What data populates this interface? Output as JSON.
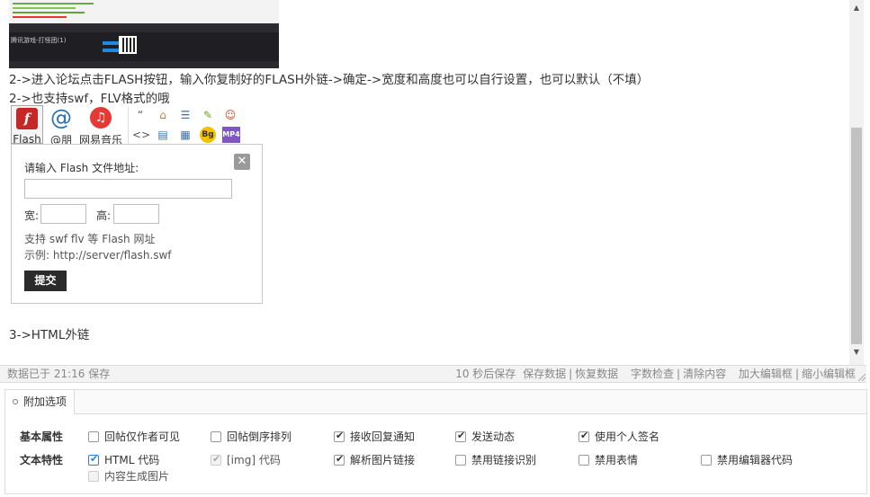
{
  "editor": {
    "line_flash_steps": "2->进入论坛点击FLASH按钮，输入你复制好的FLASH外链->确定->宽度和高度也可以自行设置，也可以默认（不填）",
    "line_swf_flv": "2->也支持swf，FLV格式的哦",
    "line_html": "3->HTML外链",
    "thumb_title": "腾讯游戏-打怪团(1)"
  },
  "toolbar": {
    "flash_label": "Flash",
    "at_label": "@朋",
    "music_label": "网易音乐",
    "flash_icon": "f",
    "music_icon": "♫",
    "small_icons": [
      {
        "name": "quote-icon",
        "glyph": "“"
      },
      {
        "name": "free-icon",
        "glyph": "⌂"
      },
      {
        "name": "hide-icon",
        "glyph": "☰"
      },
      {
        "name": "find-icon",
        "glyph": "✎"
      },
      {
        "name": "qq-icon",
        "glyph": "☺"
      },
      {
        "name": "code-icon",
        "glyph": "<>"
      },
      {
        "name": "page-icon",
        "glyph": "▤"
      },
      {
        "name": "table-icon",
        "glyph": "▦"
      },
      {
        "name": "bg-icon",
        "glyph": "Bg"
      },
      {
        "name": "mp4-icon",
        "glyph": "MP4"
      }
    ]
  },
  "flash_dialog": {
    "title": "请输入 Flash 文件地址:",
    "url_value": "",
    "width_label": "宽:",
    "width_value": "",
    "height_label": "高:",
    "height_value": "",
    "hint_formats": "支持 swf flv 等 Flash 网址",
    "hint_example": "示例: http://server/flash.swf",
    "submit_label": "提交",
    "close_label": "✕"
  },
  "status_bar": {
    "saved_text": "数据已于 21:16 保存",
    "autosave_text": "10 秒后保存",
    "save_data": "保存数据",
    "restore_data": "恢复数据",
    "word_check": "字数检查",
    "clear_content": "清除内容",
    "enlarge_editor": "加大编辑框",
    "shrink_editor": "缩小编辑框",
    "separator": "|"
  },
  "options": {
    "tab_label": "附加选项",
    "basic_label": "基本属性",
    "text_label": "文本特性",
    "basic": [
      {
        "label": "回帖仅作者可见",
        "checked": false
      },
      {
        "label": "回帖倒序排列",
        "checked": false
      },
      {
        "label": "接收回复通知",
        "checked": true
      },
      {
        "label": "发送动态",
        "checked": true
      },
      {
        "label": "使用个人签名",
        "checked": true
      }
    ],
    "text": [
      {
        "label": "HTML 代码",
        "checked": true
      },
      {
        "label": "[img] 代码",
        "checked": true
      },
      {
        "label": "解析图片链接",
        "checked": true
      },
      {
        "label": "禁用链接识别",
        "checked": false
      },
      {
        "label": "禁用表情",
        "checked": false
      },
      {
        "label": "禁用编辑器代码",
        "checked": false
      },
      {
        "label": "内容生成图片",
        "checked": false
      }
    ]
  },
  "scrollbar": {
    "up": "▲",
    "down": "▼"
  }
}
